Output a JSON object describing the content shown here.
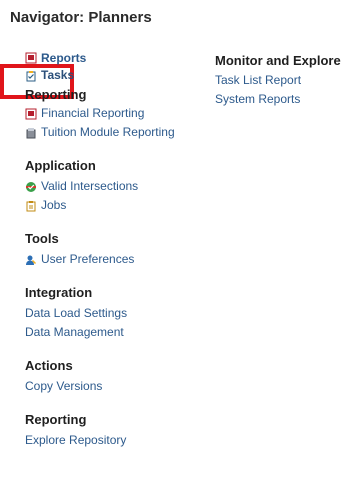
{
  "page": {
    "title": "Navigator: Planners"
  },
  "top_links": {
    "reports": "Reports",
    "tasks": "Tasks"
  },
  "left_sections": [
    {
      "title": "Reporting",
      "items": [
        "Financial Reporting",
        "Tuition Module Reporting"
      ]
    },
    {
      "title": "Application",
      "items": [
        "Valid Intersections",
        "Jobs"
      ]
    },
    {
      "title": "Tools",
      "items": [
        "User Preferences"
      ]
    },
    {
      "title": "Integration",
      "items": [
        "Data Load Settings",
        "Data Management"
      ]
    },
    {
      "title": "Actions",
      "items": [
        "Copy Versions"
      ]
    },
    {
      "title": "Reporting",
      "items": [
        "Explore Repository"
      ]
    }
  ],
  "right_section": {
    "title": "Monitor and Explore",
    "items": [
      "Task List Report",
      "System Reports"
    ]
  },
  "colors": {
    "link": "#2d5a8c",
    "highlight": "#e0151a"
  }
}
